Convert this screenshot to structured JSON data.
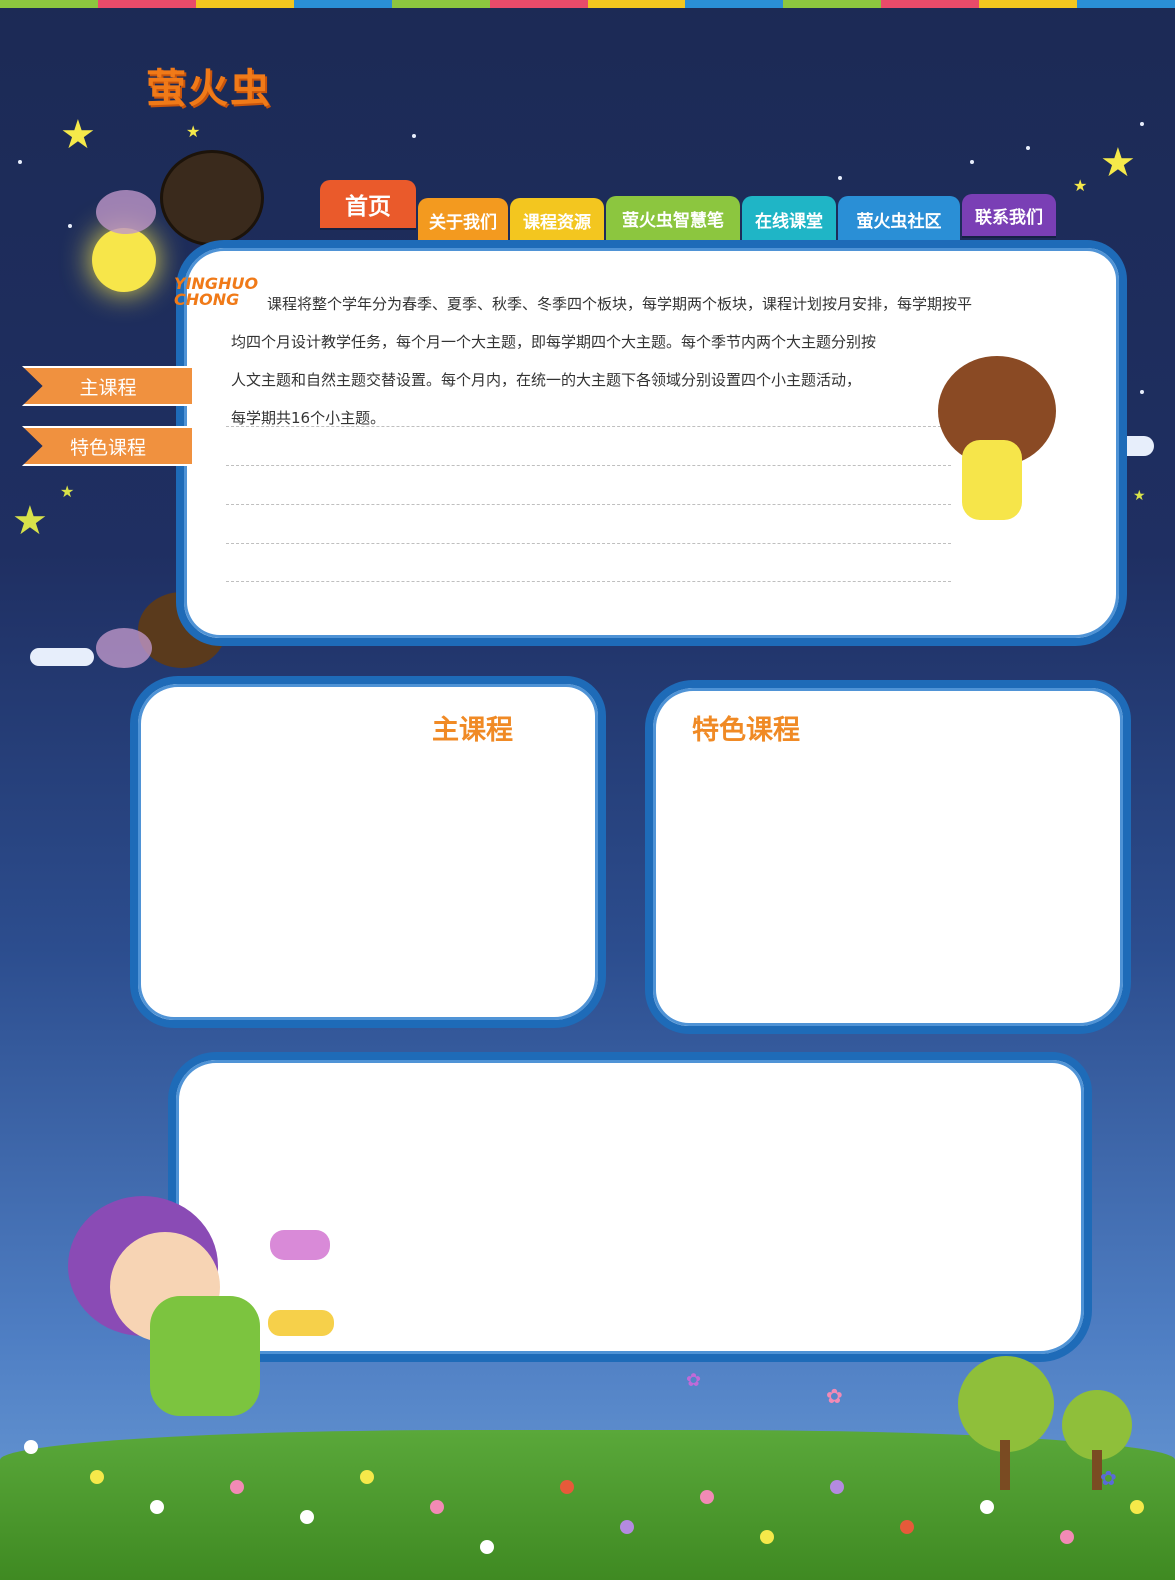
{
  "brand": {
    "logo_text": "萤火虫",
    "badge_text": "YINGHUO CHONG"
  },
  "nav": {
    "tabs": [
      {
        "label": "首页",
        "color": "#ea5a2b"
      },
      {
        "label": "关于我们",
        "color": "#f39a1f"
      },
      {
        "label": "课程资源",
        "color": "#f3c61f"
      },
      {
        "label": "萤火虫智慧笔",
        "color": "#8cc63f"
      },
      {
        "label": "在线课堂",
        "color": "#1fb5c6"
      },
      {
        "label": "萤火虫社区",
        "color": "#2a8fd6"
      },
      {
        "label": "联系我们",
        "color": "#7a3fb5"
      }
    ]
  },
  "sidebar": {
    "items": [
      {
        "label": "主课程"
      },
      {
        "label": "特色课程"
      }
    ]
  },
  "intro": {
    "lines": [
      "课程将整个学年分为春季、夏季、秋季、冬季四个板块，每学期两个板块，课程计划按月安排，每学期按平",
      "均四个月设计教学任务，每个月一个大主题，即每学期四个大主题。每个季节内两个大主题分别按",
      "人文主题和自然主题交替设置。每个月内，在统一的大主题下各领域分别设置四个小主题活动，",
      "每学期共16个小主题。"
    ]
  },
  "sections": {
    "main_title": "主课程",
    "feature_title": "特色课程"
  }
}
